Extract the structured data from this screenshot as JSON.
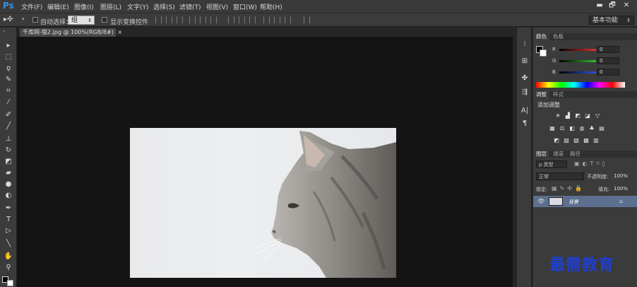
{
  "app": {
    "logo": "Ps"
  },
  "menu": {
    "items": [
      "文件(F)",
      "编辑(E)",
      "图像(I)",
      "图层(L)",
      "文字(Y)",
      "选择(S)",
      "滤镜(T)",
      "视图(V)",
      "窗口(W)",
      "帮助(H)"
    ]
  },
  "window_controls": {
    "minimize": "▬",
    "restore": "🗗",
    "close": "✕"
  },
  "options": {
    "auto_select_label": "自动选择：",
    "auto_select_value": "组",
    "show_transform_label": "显示变换控件"
  },
  "workspace": {
    "label": "基本功能"
  },
  "document": {
    "tab_title": "千库网-猫2.jpg @ 100%(RGB/8#)",
    "close": "×"
  },
  "tools": [
    "move-tool",
    "marquee-tool",
    "lasso-tool",
    "quick-select-tool",
    "crop-tool",
    "eyedropper-tool",
    "healing-brush-tool",
    "brush-tool",
    "clone-stamp-tool",
    "history-brush-tool",
    "eraser-tool",
    "gradient-tool",
    "blur-tool",
    "dodge-tool",
    "pen-tool",
    "type-tool",
    "path-select-tool",
    "line-tool",
    "hand-tool",
    "zoom-tool"
  ],
  "color_panel": {
    "tabs": [
      "颜色",
      "色板"
    ],
    "channels": [
      {
        "name": "R",
        "value": "0",
        "color": "#e03030"
      },
      {
        "name": "G",
        "value": "0",
        "color": "#30c030"
      },
      {
        "name": "B",
        "value": "0",
        "color": "#3050e0"
      }
    ]
  },
  "adjustments_panel": {
    "tabs": [
      "调整",
      "样式"
    ],
    "title": "添加调整"
  },
  "layers_panel": {
    "tabs": [
      "图层",
      "通道",
      "路径"
    ],
    "filter_label": "ρ 类型",
    "blend_mode": "正常",
    "opacity_label": "不透明度:",
    "opacity_value": "100%",
    "lock_label": "锁定:",
    "fill_label": "填充:",
    "fill_value": "100%",
    "layers": [
      {
        "name": "背景",
        "locked": true
      }
    ]
  },
  "watermark": {
    "text": "最需教育"
  }
}
